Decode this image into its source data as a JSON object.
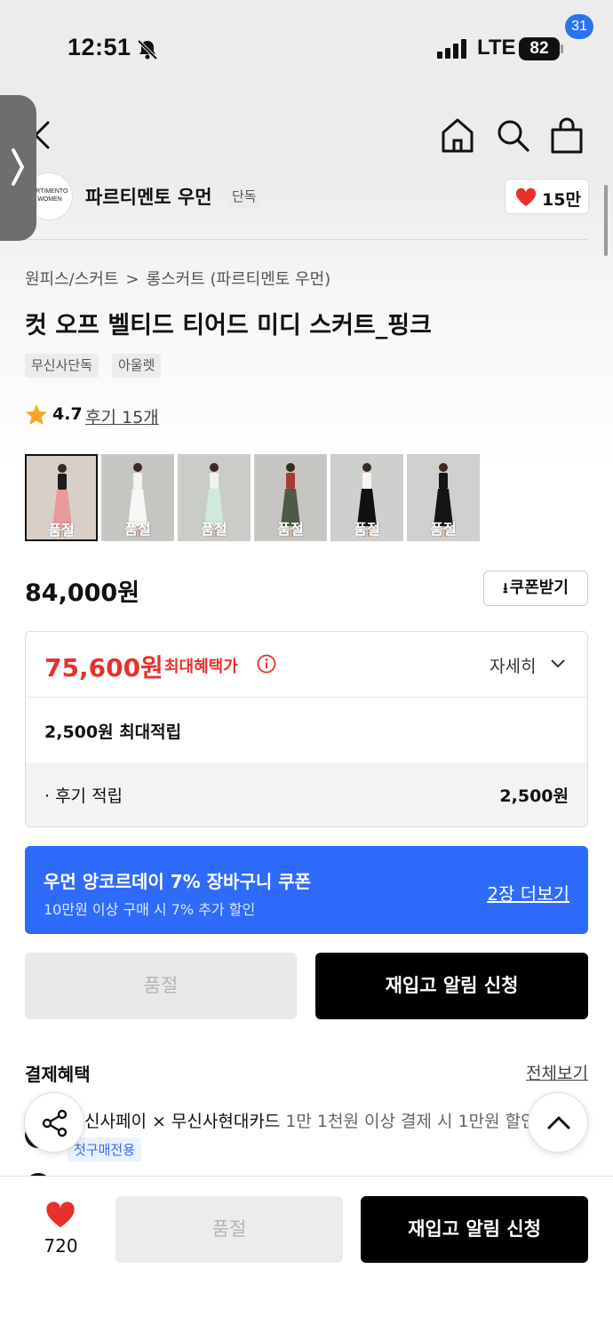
{
  "status_bar": {
    "time": "12:51",
    "network": "LTE",
    "battery": "82",
    "icons": [
      "bell-off-icon",
      "signal-icon",
      "battery-icon"
    ]
  },
  "nav": {
    "icons": [
      "back-icon",
      "home-icon",
      "search-icon",
      "bag-icon"
    ],
    "cart_badge": "31"
  },
  "side_tab": {
    "icon": "chevron-right-icon"
  },
  "brand": {
    "logo_text": "ARTIMENTO WOMEN",
    "name": "파르티멘토 우먼",
    "tag": "단독",
    "like_count": "15만"
  },
  "breadcrumb": {
    "category": "원피스/스커트",
    "separator": ">",
    "subcategory": "롱스커트 (파르티멘토 우먼)"
  },
  "product": {
    "title": "컷 오프 벨티드 티어드 미디 스커트_핑크",
    "tags": [
      "무신사단독",
      "아울렛"
    ],
    "rating": "4.7",
    "review_text": "후기 15개",
    "thumbnails": [
      {
        "label": "품절",
        "bg": "#d9cfc9",
        "top": "#1c1c1c",
        "bottom": "#e79b9b"
      },
      {
        "label": "품절",
        "bg": "#c3c6c1",
        "top": "#f4f4f2",
        "bottom": "#f7f7f5"
      },
      {
        "label": "품절",
        "bg": "#c9ccc7",
        "top": "#f1f1ee",
        "bottom": "#cfe9dd"
      },
      {
        "label": "품절",
        "bg": "#c7c5c1",
        "top": "#a43c34",
        "bottom": "#4d5a45"
      },
      {
        "label": "품절",
        "bg": "#cfcfcd",
        "top": "#f6f6f6",
        "bottom": "#111111"
      },
      {
        "label": "품절",
        "bg": "#d0d0ce",
        "top": "#151515",
        "bottom": "#151515"
      }
    ],
    "price": "84,000원",
    "coupon_button": "쿠폰받기"
  },
  "benefit": {
    "max_price": "75,600원",
    "max_label": "최대혜택가",
    "detail": "자세히",
    "points": "2,500원 최대적립",
    "review_points_label": "· 후기 적립",
    "review_points_value": "2,500원"
  },
  "coupon_banner": {
    "title": "우먼 앙코르데이 7% 장바구니 쿠폰",
    "subtitle": "10만원 이상 구매 시 7% 추가 할인",
    "more": "2장 더보기"
  },
  "actions": {
    "soldout": "품절",
    "restock": "재입고 알림 신청"
  },
  "payment": {
    "title": "결제혜택",
    "view_all": "전체보기",
    "offer_main": "신사페이 × 무신사현대카드",
    "offer_detail": " 1만 1천원 이상 결제 시 1만원 할인",
    "offer_tag": "첫구매전용"
  },
  "bottom_bar": {
    "like_count": "720",
    "soldout": "품절",
    "restock": "재입고 알림 신청"
  },
  "colors": {
    "accent_red": "#e8312b",
    "accent_blue": "#2f6bfa",
    "badge_blue": "#2a73f0"
  }
}
